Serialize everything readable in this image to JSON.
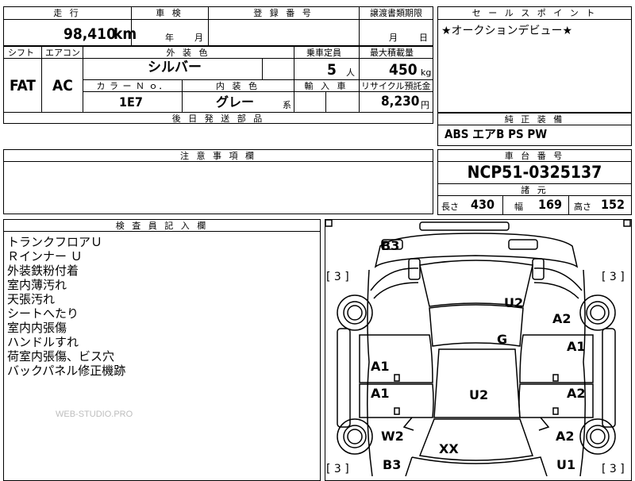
{
  "top": {
    "mileage_header": "走 行",
    "shaken_header": "車 検",
    "registration_header": "登 録 番 号",
    "transfer_header": "譲渡書類期限",
    "mileage_value": "98,410",
    "mileage_unit": "km",
    "shaken_year": "年",
    "shaken_month": "月",
    "transfer_month": "月",
    "transfer_day": "日"
  },
  "specs": {
    "shift_header": "シフト",
    "aircon_header": "エアコン",
    "exterior_header": "外 装 色",
    "capacity_header": "乗車定員",
    "load_header": "最大積載量",
    "shift_value": "FAT",
    "aircon_value": "AC",
    "exterior_value": "シルバー",
    "capacity_value": "5",
    "capacity_unit": "人",
    "load_value": "450",
    "load_unit": "kg",
    "color_no_header": "カ ラ ー Ｎ ｏ．",
    "interior_header": "内 装 色",
    "import_header": "輸 入 車",
    "recycle_header": "リサイクル預託金",
    "color_no_value": "1E7",
    "interior_value": "グレー",
    "interior_suffix": "系",
    "recycle_value": "8,230",
    "recycle_unit": "円",
    "later_parts_header": "後 日 発 送 部 品"
  },
  "sales": {
    "header": "セ ー ル ス ポ イ ン ト",
    "text": "★オークションデビュー★"
  },
  "equipment": {
    "header": "純 正 装 備",
    "text": "ABS エアB PS PW"
  },
  "notes": {
    "header": "注 意 事 項 欄"
  },
  "chassis": {
    "header": "車 台 番 号",
    "value": "NCP51-0325137",
    "dims_header": "諸 元",
    "length_label": "長さ",
    "length_value": "430",
    "width_label": "幅",
    "width_value": "169",
    "height_label": "高さ",
    "height_value": "152"
  },
  "inspector": {
    "header": "検 査 員 記 入 欄",
    "lines": [
      "トランクフロアＵ",
      "Ｒインナー Ｕ",
      "外装鉄粉付着",
      "室内薄汚れ",
      "天張汚れ",
      "シートへたり",
      "室内内張傷",
      "ハンドルすれ",
      "荷室内張傷、ビス穴",
      "バックパネル修正機跡"
    ],
    "watermark": "WEB-STUDIO.PRO"
  },
  "diagram": {
    "tire_labels": [
      "[ 3 ]",
      "[ 3 ]",
      "[ 3 ]",
      "[ 3 ]"
    ],
    "marks": {
      "rear_b3": "B3",
      "u2_rear_window": "U2",
      "a2_right_rear": "A2",
      "g_roof": "G",
      "a1_right_rear_door": "A1",
      "a1_left_rear_door": "A1",
      "a1_left_front_door": "A1",
      "u2_floor": "U2",
      "a2_right_front_door": "A2",
      "w2_left_front": "W2",
      "a2_right_front": "A2",
      "xx_hood": "XX",
      "b3_front": "B3",
      "u1_front": "U1"
    }
  }
}
